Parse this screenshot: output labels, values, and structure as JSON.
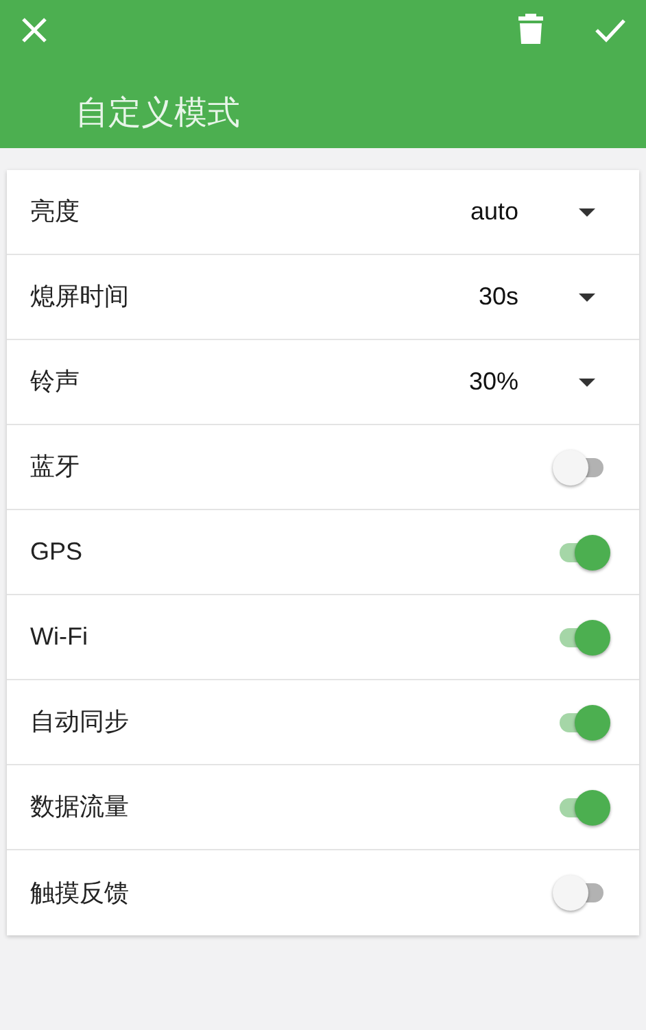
{
  "header": {
    "title": "自定义模式"
  },
  "rows": [
    {
      "kind": "dropdown",
      "label": "亮度",
      "value": "auto"
    },
    {
      "kind": "dropdown",
      "label": "熄屏时间",
      "value": "30s"
    },
    {
      "kind": "dropdown",
      "label": "铃声",
      "value": "30%"
    },
    {
      "kind": "toggle",
      "label": "蓝牙",
      "on": false
    },
    {
      "kind": "toggle",
      "label": "GPS",
      "on": true
    },
    {
      "kind": "toggle",
      "label": "Wi-Fi",
      "on": true
    },
    {
      "kind": "toggle",
      "label": "自动同步",
      "on": true
    },
    {
      "kind": "toggle",
      "label": "数据流量",
      "on": true
    },
    {
      "kind": "toggle",
      "label": "触摸反馈",
      "on": false
    }
  ]
}
